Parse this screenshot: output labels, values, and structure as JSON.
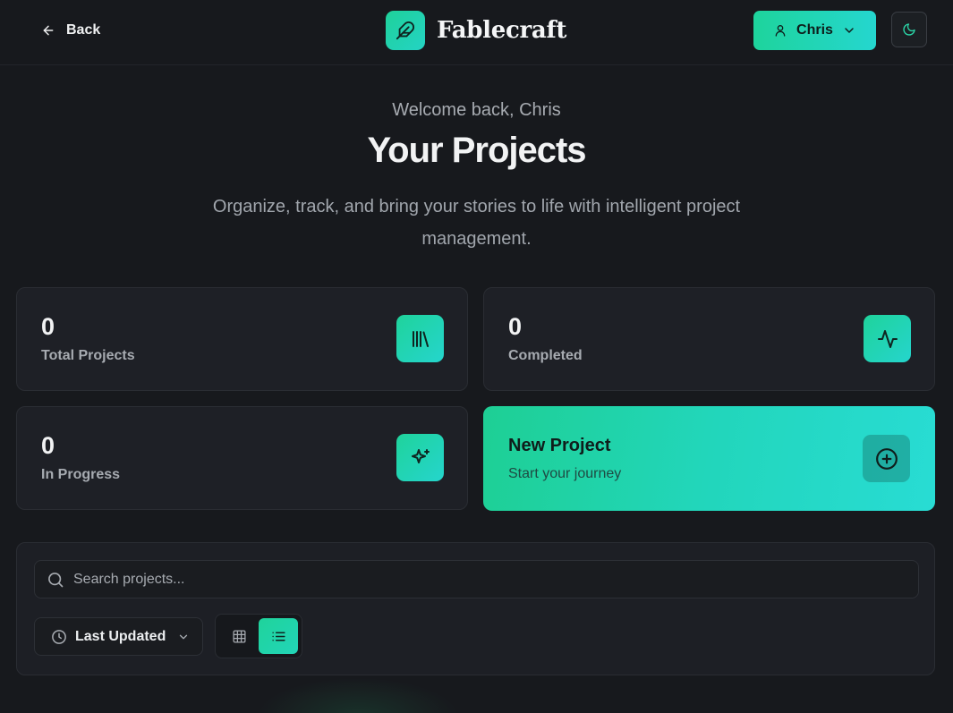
{
  "header": {
    "back_label": "Back",
    "brand_name": "Fablecraft",
    "user_name": "Chris"
  },
  "hero": {
    "welcome": "Welcome back, Chris",
    "title": "Your Projects",
    "subtitle": "Organize, track, and bring your stories to life with intelligent project management."
  },
  "stats": {
    "total": {
      "value": "0",
      "label": "Total Projects"
    },
    "completed": {
      "value": "0",
      "label": "Completed"
    },
    "in_progress": {
      "value": "0",
      "label": "In Progress"
    }
  },
  "new_project": {
    "title": "New Project",
    "subtitle": "Start your journey"
  },
  "toolbar": {
    "search_placeholder": "Search projects...",
    "search_value": "",
    "sort_label": "Last Updated",
    "view_mode": "list"
  },
  "colors": {
    "accent": "#1fd39b",
    "accent_end": "#25d6cf",
    "background": "#17191d",
    "card": "#1e2026"
  },
  "icons": {
    "back": "arrow-left-icon",
    "brand": "feather-icon",
    "user": "user-icon",
    "theme": "moon-icon",
    "total": "library-icon",
    "completed": "activity-icon",
    "in_progress": "sparkles-icon",
    "new_project": "plus-circle-icon",
    "search": "search-icon",
    "sort": "clock-icon",
    "grid": "grid-icon",
    "list": "list-icon"
  }
}
